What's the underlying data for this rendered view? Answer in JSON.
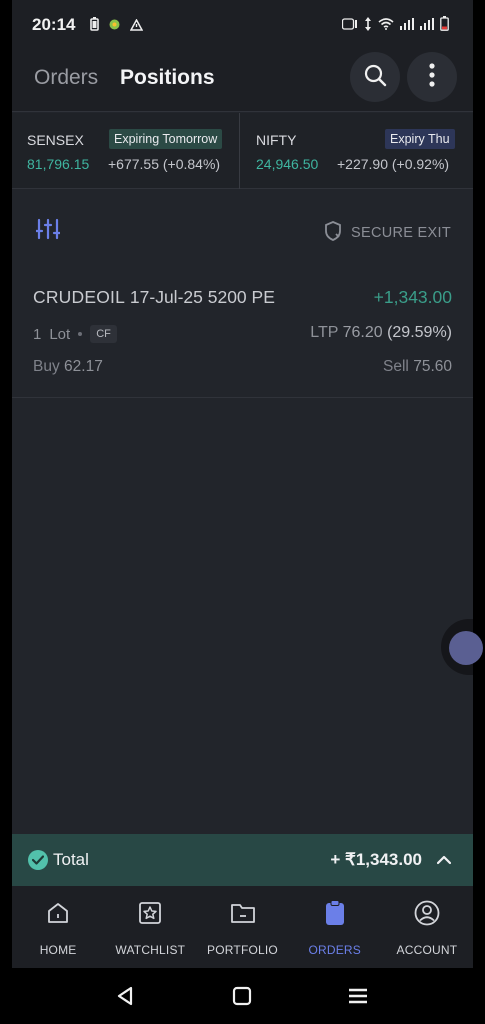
{
  "status_bar": {
    "time": "20:14"
  },
  "header": {
    "tabs": [
      {
        "label": "Orders",
        "active": false
      },
      {
        "label": "Positions",
        "active": true
      }
    ]
  },
  "indices": [
    {
      "name": "SENSEX",
      "badge": "Expiring Tomorrow",
      "value": "81,796.15",
      "change": "+677.55 (+0.84%)"
    },
    {
      "name": "NIFTY",
      "badge": "Expiry Thu",
      "value": "24,946.50",
      "change": "+227.90 (+0.92%)"
    }
  ],
  "toolbar": {
    "secure_exit_label": "SECURE EXIT"
  },
  "position": {
    "instrument": "CRUDEOIL",
    "contract": "17-Jul-25 5200 PE",
    "pnl": "+1,343.00",
    "qty": "1",
    "qty_unit": "Lot",
    "tag": "CF",
    "ltp_label": "LTP",
    "ltp_value": "76.20",
    "ltp_change": "(29.59%)",
    "buy_label": "Buy",
    "buy_price": "62.17",
    "sell_label": "Sell",
    "sell_price": "75.60"
  },
  "total": {
    "label": "Total",
    "value": "+ ₹1,343.00"
  },
  "nav": [
    {
      "label": "HOME",
      "icon": "home-icon",
      "active": false
    },
    {
      "label": "WATCHLIST",
      "icon": "watchlist-icon",
      "active": false
    },
    {
      "label": "PORTFOLIO",
      "icon": "portfolio-icon",
      "active": false
    },
    {
      "label": "ORDERS",
      "icon": "orders-icon",
      "active": true
    },
    {
      "label": "ACCOUNT",
      "icon": "account-icon",
      "active": false
    }
  ],
  "colors": {
    "accent": "#6b7fe8",
    "profit": "#3fb5a0",
    "background": "#22252b"
  }
}
